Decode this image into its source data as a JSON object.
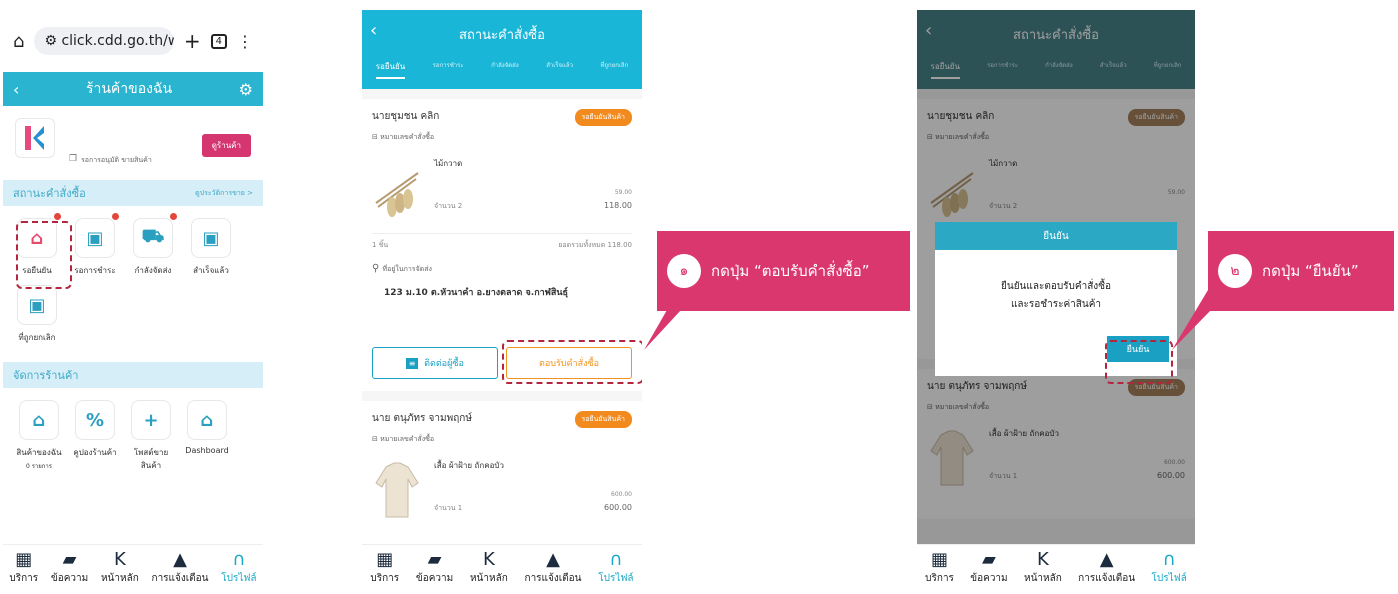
{
  "phone1": {
    "browser": {
      "url": "click.cdd.go.th/web/",
      "tab_count": "4"
    },
    "header": {
      "title": "ร้านค้าของฉัน"
    },
    "shop": {
      "view_button": "ดูร้านค้า",
      "status": "รอการอนุมัติ ขายสินค้า"
    },
    "order_status": {
      "title": "สถานะคำสั่งซื้อ",
      "history_link": "ดูประวัติการขาย >"
    },
    "order_items": [
      {
        "label": "รอยืนยัน",
        "icon": "basket-clock-icon",
        "color": "#e84a6b",
        "dot": true
      },
      {
        "label": "รอการชำระ",
        "icon": "wallet-minus-icon",
        "color": "#2a9fc0",
        "dot": true
      },
      {
        "label": "กำลังจัดส่ง",
        "icon": "truck-icon",
        "color": "#2a9fc0",
        "dot": true
      },
      {
        "label": "สำเร็จแล้ว",
        "icon": "box-check-icon",
        "color": "#2a9fc0",
        "dot": false
      },
      {
        "label": "ที่ถูกยกเลิก",
        "icon": "box-cancel-icon",
        "color": "#2a9fc0",
        "dot": false
      }
    ],
    "manage": {
      "title": "จัดการร้านค้า"
    },
    "manage_items": [
      {
        "label": "สินค้าของฉัน",
        "sub": "0 รายการ",
        "icon": "basket-icon",
        "color": "#2a9fc0"
      },
      {
        "label": "คูปองร้านค้า",
        "sub": "",
        "icon": "coupon-icon",
        "color": "#2a9fc0"
      },
      {
        "label": "โพสต์ขายสินค้า",
        "sub": "",
        "icon": "plus-circle-icon",
        "color": "#2a9fc0"
      },
      {
        "label": "Dashboard",
        "sub": "",
        "icon": "basket-stat-icon",
        "color": "#2a9fc0"
      }
    ]
  },
  "nav": [
    {
      "label": "บริการ",
      "icon": "services-icon"
    },
    {
      "label": "ข้อความ",
      "icon": "message-icon"
    },
    {
      "label": "หน้าหลัก",
      "icon": "home-logo-icon"
    },
    {
      "label": "การแจ้งเตือน",
      "icon": "bell-icon"
    },
    {
      "label": "โปรไฟล์",
      "icon": "profile-icon"
    }
  ],
  "orders_screen": {
    "title": "สถานะคำสั่งซื้อ",
    "tabs": [
      "รอยืนยัน",
      "รอการชำระ",
      "กำลังจัดส่ง",
      "สำเร็จแล้ว",
      "ที่ถูกยกเลิก"
    ],
    "order1": {
      "customer": "นายชุมชน คลิก",
      "badge": "รอยืนยันสินค้า",
      "order_no_label": "หมายเลขคำสั่งซื้อ",
      "product": "ไม้กวาด",
      "qty": "จำนวน 2",
      "unit_price": "59.00",
      "price": "118.00",
      "item_count": "1 ชิ้น",
      "total": "ยอดรวมทั้งหมด 118.00",
      "address_label": "ที่อยู่ในการจัดส่ง",
      "address": "123 ม.10 ต.หัวนาคำ อ.ยางตลาด จ.กาฬสินธุ์"
    },
    "contact_button": "ติดต่อผู้ซื้อ",
    "accept_button": "ตอบรับคำสั่งซื้อ",
    "order2": {
      "customer": "นาย ตนุภัทร จามพฤกษ์",
      "badge": "รอยืนยันสินค้า",
      "order_no_label": "หมายเลขคำสั่งซื้อ",
      "product": "เสื้อ ผ้าฝ้าย ถักคอบัว",
      "qty": "จำนวน 1",
      "unit_price": "600.00",
      "price": "600.00"
    }
  },
  "modal": {
    "title": "ยืนยัน",
    "message_line1": "ยืนยันและตอบรับคำสั่งซื้อ",
    "message_line2": "และรอชำระค่าสินค้า",
    "confirm": "ยืนยัน"
  },
  "callouts": [
    {
      "number": "๑",
      "text": "กดปุ่ม “ตอบรับคำสั่งซื้อ”"
    },
    {
      "number": "๒",
      "text": "กดปุ่ม “ยืนยัน”"
    }
  ],
  "colors": {
    "teal": "#2ab4d0",
    "teal_dark": "#4a858c",
    "callout": "#d9376e",
    "orange": "#f2941f",
    "brown": "#a7825d"
  }
}
